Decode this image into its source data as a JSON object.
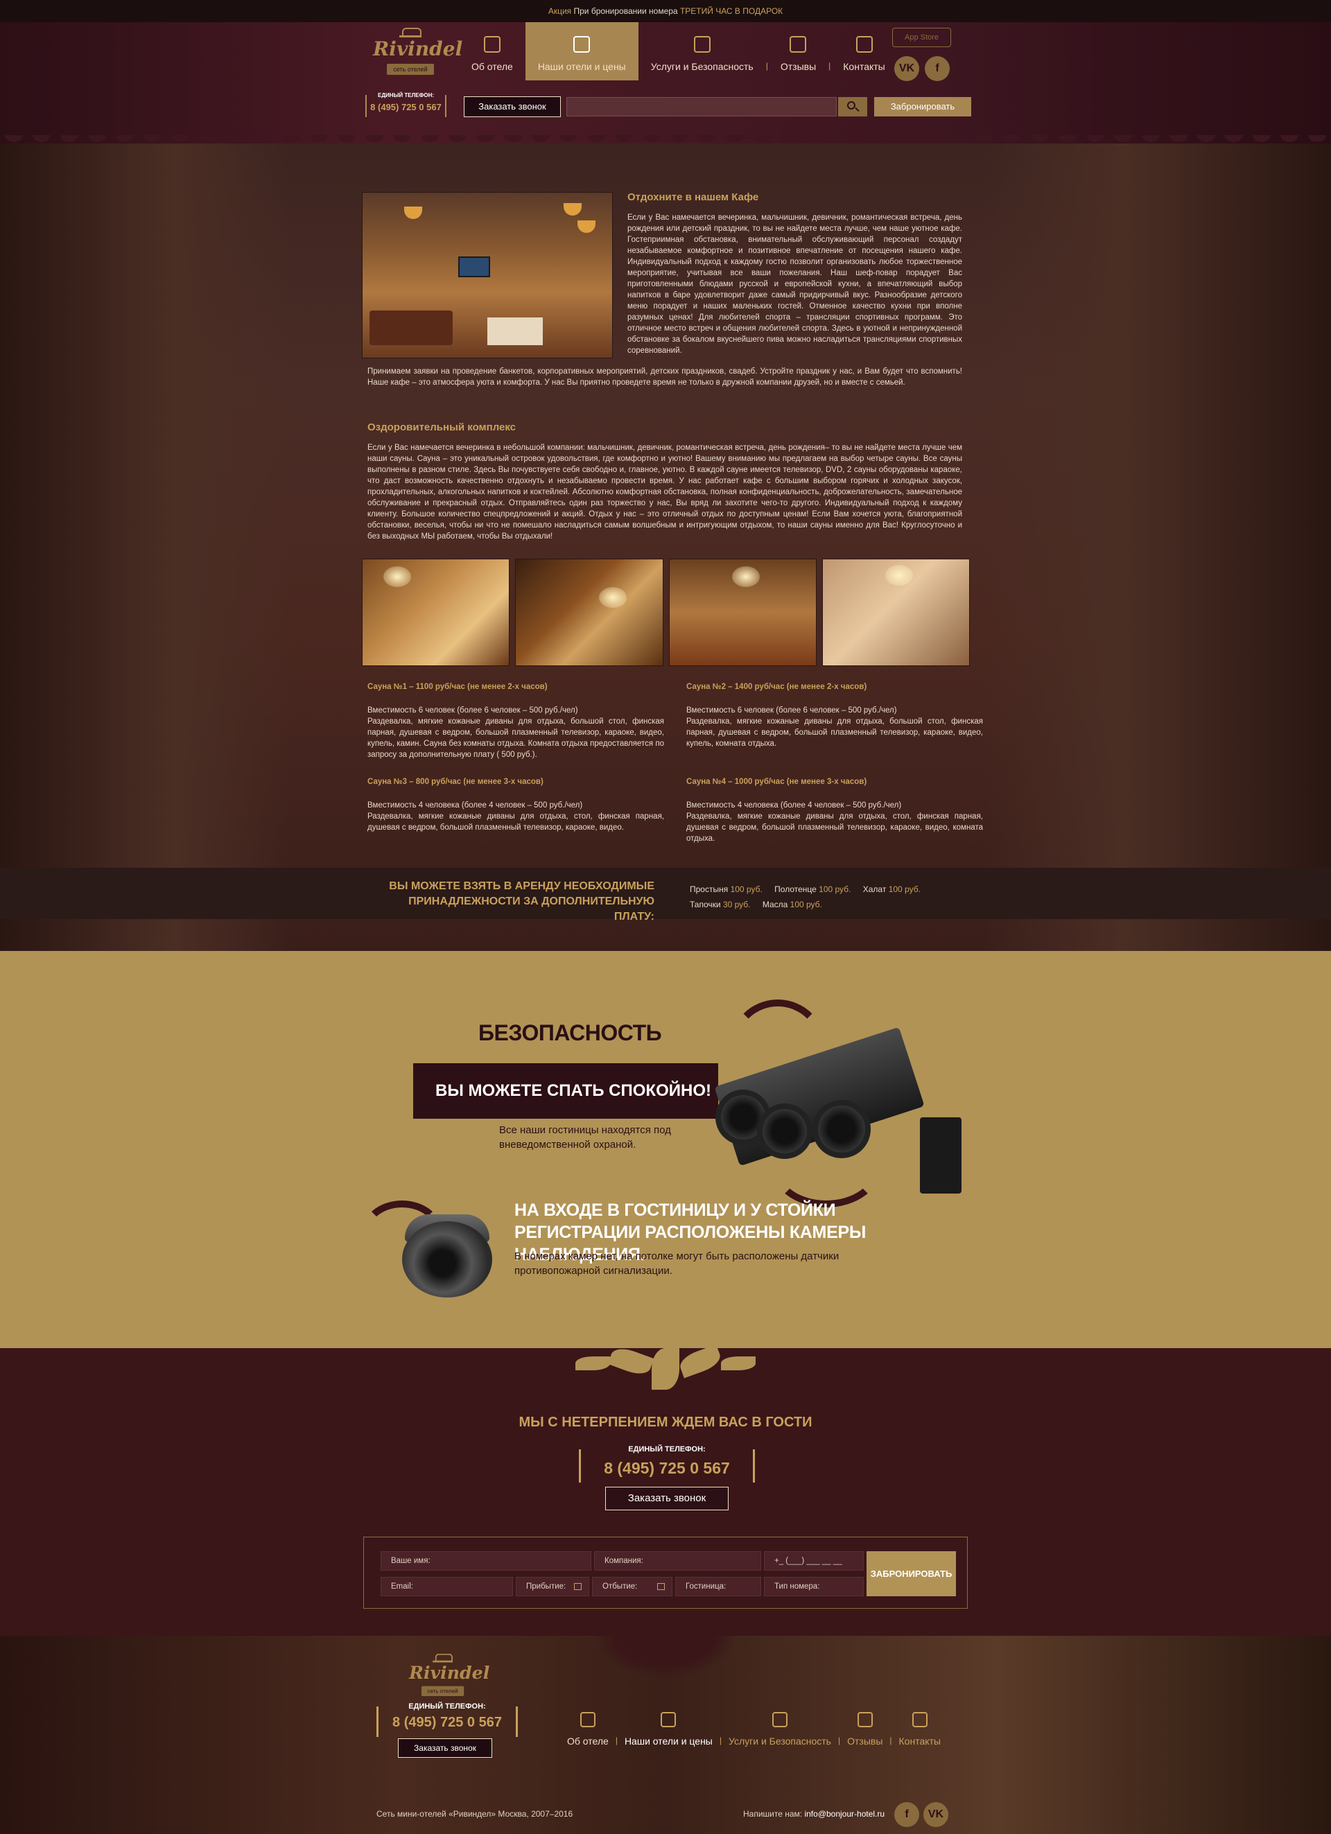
{
  "promo": {
    "prefix": "Акция",
    "text": "При бронировании номера",
    "highlight": "ТРЕТИЙ ЧАС В ПОДАРОК"
  },
  "logo": {
    "name": "Rivindel",
    "tag": "сеть отелей"
  },
  "nav": [
    {
      "label": "Об отеле",
      "icon": "house-icon"
    },
    {
      "label": "Наши отели и цены",
      "icon": "hotel-icon",
      "active": true
    },
    {
      "label": "Услуги и Безопасность",
      "icon": "services-icon"
    },
    {
      "label": "Отзывы",
      "icon": "award-icon"
    },
    {
      "label": "Контакты",
      "icon": "map-icon"
    }
  ],
  "header": {
    "appstore": "App Store",
    "phone_label": "ЕДИНЫЙ ТЕЛЕФОН:",
    "phone": "8 (495) 725 0 567",
    "call_button": "Заказать звонок",
    "book_button": "Забронировать",
    "social": [
      "VK",
      "f"
    ]
  },
  "cafe": {
    "title": "Отдохните в нашем Кафе",
    "text": "Если у Вас намечается вечеринка, мальчишник, девичник, романтическая встреча, день рождения или детский праздник, то вы не найдете места лучше, чем наше уютное кафе. Гостеприимная обстановка, внимательный обслуживающий персонал создадут незабываемое комфортное и позитивное впечатление от посещения нашего кафе. Индивидуальный подход к каждому гостю позволит организовать любое торжественное мероприятие, учитывая все ваши пожелания. Наш шеф-повар порадует Вас приготовленными блюдами русской и европейской кухни, а впечатляющий выбор напитков в баре удовлетворит даже самый придирчивый вкус. Разнообразие детского меню порадует и наших маленьких гостей. Отменное качество кухни при вполне разумных ценах! Для любителей спорта – трансляции спортивных программ. Это отличное место встреч и общения любителей спорта. Здесь в уютной и непринужденной обстановке за бокалом вкуснейшего пива можно насладиться трансляциями спортивных соревнований.",
    "text2": "Принимаем заявки на проведение банкетов, корпоративных мероприятий, детских праздников, свадеб. Устройте праздник у нас, и Вам будет что вспомнить! Наше кафе – это атмосфера уюта и комфорта. У нас Вы приятно проведете время не только в дружной компании друзей, но и вместе с семьей."
  },
  "spa": {
    "title": "Оздоровительный комплекс",
    "text": "Если у Вас намечается вечеринка в небольшой компании: мальчишник, девичник, романтическая встреча, день рождения– то вы не найдете места лучше чем наши сауны. Сауна – это уникальный островок удовольствия, где комфортно и уютно! Вашему вниманию мы предлагаем на выбор четыре сауны. Все сауны выполнены в разном стиле. Здесь Вы почувствуете себя свободно и, главное, уютно. В каждой сауне имеется телевизор, DVD, 2 сауны оборудованы караоке, что даст возможность качественно отдохнуть и незабываемо провести время. У нас работает кафе с большим выбором горячих и холодных закусок, прохладительных, алкогольных напитков и коктейлей. Абсолютно комфортная обстановка, полная конфиденциальность, доброжелательность, замечательное обслуживание и прекрасный отдых. Отправляйтесь один раз торжество у нас, Вы вряд ли захотите чего-то другого. Индивидуальный подход к каждому клиенту. Большое количество спецпредложений и акций. Отдых у нас – это отличный отдых по доступным ценам! Если Вам хочется уюта, благоприятной обстановки, веселья, чтобы ни что не помешало насладиться самым волшебным и интригующим отдыхом, то наши сауны именно для Вас! Круглосуточно и без выходных МЫ работаем, чтобы Вы отдыхали!"
  },
  "saunas": [
    {
      "title": "Сауна №1 – 1100 руб/час (не менее 2-х часов)",
      "capacity": "Вместимость 6 человек (более 6 человек – 500 руб./чел)",
      "desc": "Раздевалка, мягкие кожаные диваны для отдыха, большой стол, финская парная, душевая с ведром, большой плазменный телевизор, караоке, видео, купель, камин. Сауна без комнаты отдыха. Комната отдыха предоставляется по запросу за дополнительную плату ( 500 руб.)."
    },
    {
      "title": "Сауна №2 – 1400 руб/час (не менее 2-х часов)",
      "capacity": "Вместимость 6 человек (более 6 человек – 500 руб./чел)",
      "desc": "Раздевалка, мягкие кожаные диваны для отдыха, большой стол, финская парная, душевая с ведром, большой плазменный телевизор, караоке, видео, купель, комната отдыха."
    },
    {
      "title": "Сауна №3 – 800 руб/час (не менее 3-х часов)",
      "capacity": "Вместимость 4 человека (более 4 человек – 500 руб./чел)",
      "desc": "Раздевалка, мягкие кожаные диваны для отдыха, стол, финская парная, душевая с ведром, большой плазменный телевизор, караоке, видео."
    },
    {
      "title": "Сауна №4 – 1000 руб/час (не менее 3-х часов)",
      "capacity": "Вместимость 4 человека (более 4 человек – 500 руб./чел)",
      "desc": "Раздевалка, мягкие кожаные диваны для отдыха, стол, финская парная, душевая с ведром, большой плазменный телевизор, караоке, видео, комната отдыха."
    }
  ],
  "rental": {
    "title_line1": "ВЫ МОЖЕТЕ ВЗЯТЬ В АРЕНДУ НЕОБХОДИМЫЕ",
    "title_line2": "ПРИНАДЛЕЖНОСТИ ЗА ДОПОЛНИТЕЛЬНУЮ ПЛАТУ:",
    "items": [
      {
        "name": "Простыня",
        "price": "100 руб."
      },
      {
        "name": "Полотенце",
        "price": "100 руб."
      },
      {
        "name": "Халат",
        "price": "100 руб."
      },
      {
        "name": "Тапочки",
        "price": "30 руб."
      },
      {
        "name": "Масла",
        "price": "100 руб."
      }
    ]
  },
  "security": {
    "title": "БЕЗОПАСНОСТЬ",
    "banner": "ВЫ МОЖЕТЕ СПАТЬ СПОКОЙНО!",
    "sub": "Все наши гостиницы находятся под вневедомственной охраной.",
    "h2": "НА ВХОДЕ В ГОСТИНИЦУ И У СТОЙКИ РЕГИСТРАЦИИ РАСПОЛОЖЕНЫ КАМЕРЫ НАБЛЮДЕНИЯ.",
    "p2": "В номерах камер нет, на потолке могут быть расположены датчики противопожарной сигнализации."
  },
  "contact": {
    "title": "МЫ С НЕТЕРПЕНИЕМ ЖДЕМ ВАС В ГОСТИ",
    "phone_label": "ЕДИНЫЙ ТЕЛЕФОН:",
    "phone": "8 (495) 725 0 567",
    "call_button": "Заказать звонок"
  },
  "form": {
    "name": "Ваше имя:",
    "company": "Компания:",
    "phone": "+_ (___) ___ __ __",
    "email": "Email:",
    "arrival": "Прибытие:",
    "departure": "Отбытие:",
    "hotel": "Гостиница:",
    "room_type": "Тип номера:",
    "submit": "ЗАБРОНИРОВАТЬ"
  },
  "footer": {
    "phone_label": "ЕДИНЫЙ ТЕЛЕФОН:",
    "phone": "8 (495) 725 0 567",
    "call_button": "Заказать звонок",
    "copyright": "Сеть мини-отелей «Ривиндел» Москва, 2007–2016",
    "mail_label": "Напишите нам:",
    "mail": "info@bonjour-hotel.ru",
    "social": [
      "f",
      "VK"
    ]
  }
}
